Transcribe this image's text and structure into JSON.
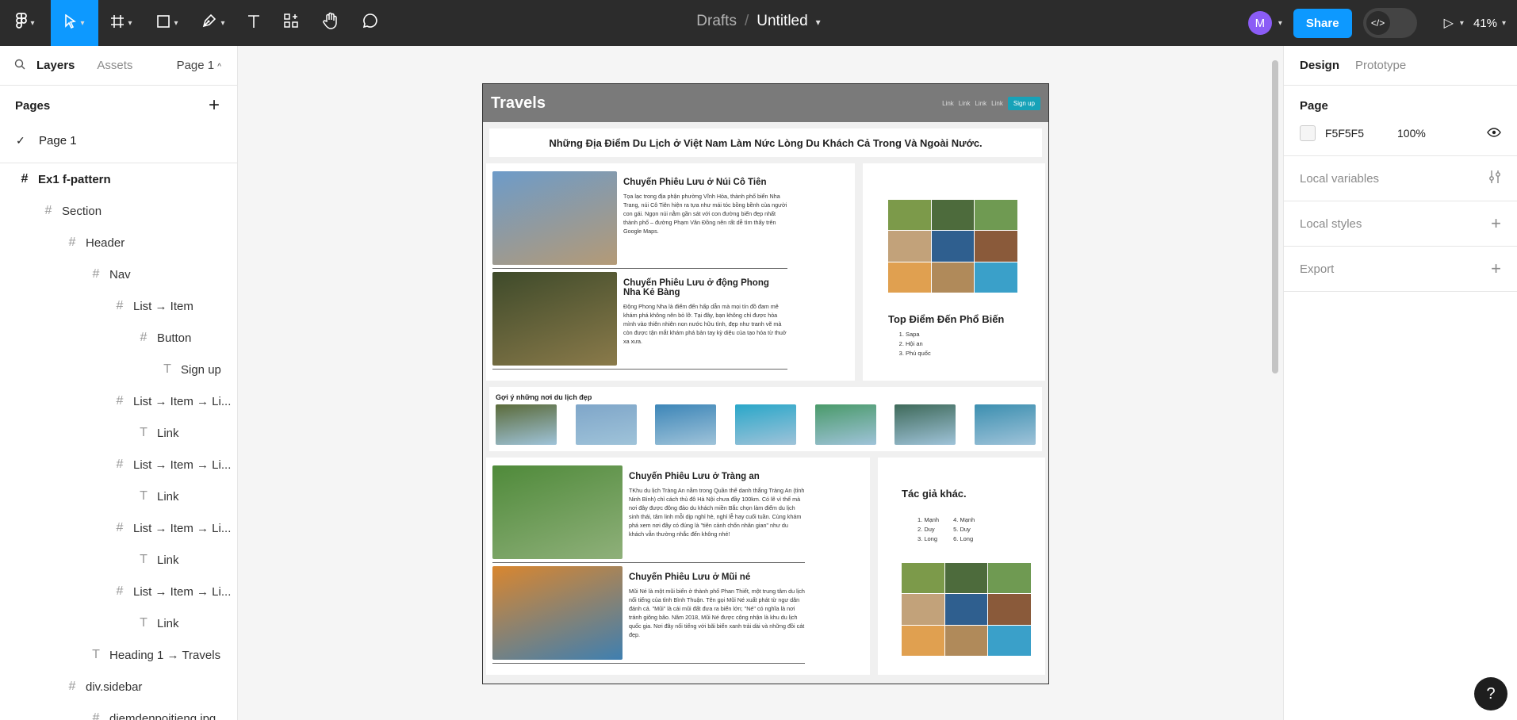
{
  "toolbar": {
    "breadcrumb_root": "Drafts",
    "breadcrumb_sep": "/",
    "file_name": "Untitled",
    "avatar_initial": "M",
    "share_label": "Share",
    "zoom": "41%",
    "tools": [
      "figma-menu-icon",
      "move-icon",
      "frame-icon",
      "shape-icon",
      "pen-icon",
      "text-icon",
      "resources-icon",
      "hand-icon",
      "comment-icon"
    ]
  },
  "left": {
    "tab_layers": "Layers",
    "tab_assets": "Assets",
    "page_selector": "Page 1",
    "pages_label": "Pages",
    "pages": [
      "Page 1"
    ],
    "layers": [
      {
        "label": "Ex1 f-pattern",
        "icon": "#",
        "indent": 0,
        "bold": true
      },
      {
        "label": "Section",
        "icon": "#",
        "indent": 1
      },
      {
        "label": "Header",
        "icon": "#",
        "indent": 2
      },
      {
        "label": "Nav",
        "icon": "#",
        "indent": 3
      },
      {
        "label": "List → Item",
        "icon": "#",
        "indent": 4
      },
      {
        "label": "Button",
        "icon": "#",
        "indent": 5
      },
      {
        "label": "Sign up",
        "icon": "T",
        "indent": 6
      },
      {
        "label": "List → Item → Li...",
        "icon": "#",
        "indent": 4
      },
      {
        "label": "Link",
        "icon": "T",
        "indent": 5
      },
      {
        "label": "List → Item → Li...",
        "icon": "#",
        "indent": 4
      },
      {
        "label": "Link",
        "icon": "T",
        "indent": 5
      },
      {
        "label": "List → Item → Li...",
        "icon": "#",
        "indent": 4
      },
      {
        "label": "Link",
        "icon": "T",
        "indent": 5
      },
      {
        "label": "List → Item → Li...",
        "icon": "#",
        "indent": 4
      },
      {
        "label": "Link",
        "icon": "T",
        "indent": 5
      },
      {
        "label": "Heading 1 → Travels",
        "icon": "T",
        "indent": 3
      },
      {
        "label": "div.sidebar",
        "icon": "#",
        "indent": 2
      },
      {
        "label": "diemdenpoitieng.jpg",
        "icon": "#",
        "indent": 3
      }
    ]
  },
  "right": {
    "tab_design": "Design",
    "tab_prototype": "Prototype",
    "page_section": "Page",
    "page_color": "F5F5F5",
    "page_opacity": "100%",
    "local_variables": "Local variables",
    "local_styles": "Local styles",
    "export": "Export",
    "help": "?"
  },
  "frame": {
    "title": "Travels",
    "nav_links": [
      "Link",
      "Link",
      "Link",
      "Link"
    ],
    "signup": "Sign up",
    "banner": "Những Địa Điểm Du Lịch ở Việt Nam Làm Nức Lòng Du Khách Cả Trong Và Ngoài Nước.",
    "articles_top": [
      {
        "title": "Chuyến Phiêu Lưu ở Núi Cô Tiên",
        "text": "Tọa lạc trong địa phận phường Vĩnh Hòa, thành phố biển Nha Trang, núi Cô Tiên hiện ra tựa như mái tóc bồng bềnh của người con gái. Ngọn núi nằm gần sát với con đường biển đẹp nhất thành phố – đường Phạm Văn Đồng nên rất dễ tìm thấy trên Google Maps.",
        "colors": [
          "#6d9bc9",
          "#b49a76"
        ]
      },
      {
        "title": "Chuyến Phiêu Lưu ở động Phong Nha Kẻ Bàng",
        "text": "Động Phong Nha là điểm đến hấp dẫn mà mọi tín đồ đam mê khám phá không nên bỏ lỡ. Tại đây, bạn không chỉ được hòa mình vào thiên nhiên non nước hữu tình, đẹp như tranh vẽ mà còn được tận mắt khám phá bản tay kỳ diệu của tạo hóa từ thuở xa xưa.",
        "colors": [
          "#3e4a2a",
          "#8a7a4a"
        ]
      }
    ],
    "side_top": {
      "heading": "Top Điểm Đến Phổ Biến",
      "items": [
        "Sapa",
        "Hội an",
        "Phú quốc"
      ]
    },
    "suggest": {
      "title": "Gợi ý những nơi du lịch đẹp",
      "colors": [
        "#5b6b3a",
        "#7fa6c9",
        "#3d86b8",
        "#2aa7c9",
        "#4a9a6a",
        "#3f6a5a",
        "#3c8fb0"
      ]
    },
    "articles_bottom": [
      {
        "title": "Chuyến Phiêu Lưu ở Tràng an",
        "text": "TKhu du lịch Tràng An nằm trong Quần thể danh thắng Tràng An (tỉnh Ninh Bình) chỉ cách thủ đô Hà Nội chưa đầy 100km. Có lẽ vì thế mà nơi đây được đông đảo du khách miền Bắc chọn làm điểm du lịch sinh thái, tâm linh mỗi dịp nghỉ hè, nghỉ lễ hay cuối tuần. Cùng khám phá xem nơi đây có đúng là \"tiên cảnh chốn nhân gian\" như du khách vẫn thường nhắc đến không nhé!",
        "colors": [
          "#4f8a3a",
          "#8fb07a"
        ]
      },
      {
        "title": "Chuyến Phiêu Lưu ở Mũi né",
        "text": "Mũi Né là một mũi biển ở thành phố Phan Thiết, một trung tâm du lịch nổi tiếng của tỉnh Bình Thuận. Tên gọi Mũi Né xuất phát từ ngư dân đánh cá. \"Mũi\" là cái mũi đất đưa ra biển lớn; \"Né\" có nghĩa là nơi tránh giông bão. Năm 2018, Mũi Né được công nhận là khu du lịch quốc gia. Nơi đây nổi tiếng với bãi biển xanh trải dài và những đồi cát đẹp.",
        "colors": [
          "#d9862f",
          "#3f7fb0"
        ]
      }
    ],
    "side_bottom": {
      "heading": "Tác giả khác.",
      "col1": [
        "Mạnh",
        "Duy",
        "Long"
      ],
      "col2": [
        "Mạnh",
        "Duy",
        "Long"
      ]
    },
    "grid_colors": [
      "#7c9a4a",
      "#4d6b3c",
      "#6f9a52",
      "#c2a27a",
      "#2f5f8f",
      "#8a5a3a",
      "#e0a050",
      "#b08a5a",
      "#3aa0c9"
    ]
  }
}
